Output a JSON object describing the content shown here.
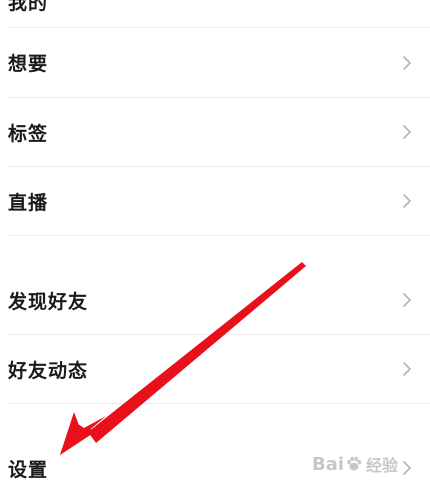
{
  "menu": {
    "top_partial": {
      "label": "我的"
    },
    "items": [
      {
        "label": "想要"
      },
      {
        "label": "标签"
      },
      {
        "label": "直播"
      },
      {
        "label": "发现好友"
      },
      {
        "label": "好友动态"
      },
      {
        "label": "设置"
      }
    ]
  },
  "watermark": {
    "brand": "Bai",
    "suffix": "经验"
  },
  "colors": {
    "annotation_arrow": "#e8101a",
    "chevron": "#b8b8b8",
    "divider": "#ececec",
    "text": "#1a1a1a"
  },
  "icons": {
    "chevron": "chevron-right-icon",
    "arrow": "annotation-arrow"
  }
}
